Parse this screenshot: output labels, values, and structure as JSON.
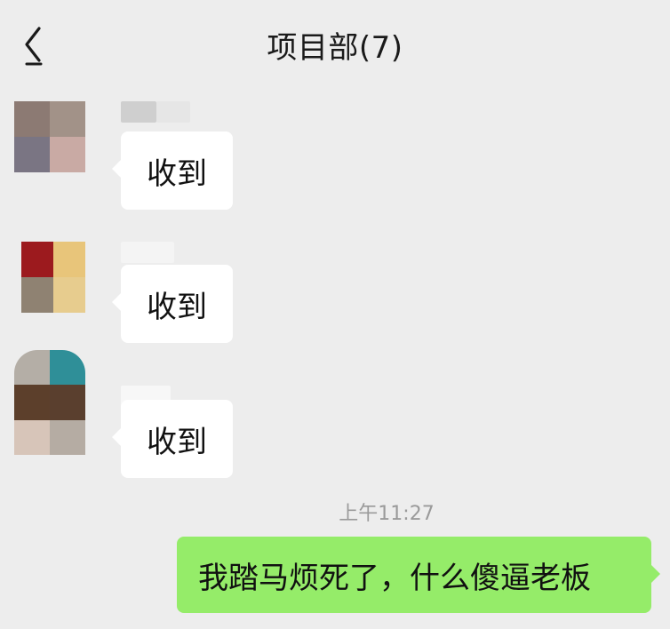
{
  "header": {
    "title": "项目部(7)",
    "back_icon": "chevron-left-icon"
  },
  "messages": [
    {
      "sender": "other",
      "text": "收到",
      "avatar_colors": [
        "#8c7a73",
        "#a29288",
        "#7a7583",
        "#c9aaa4"
      ],
      "name_colors": [
        "#cfcfcf",
        "#e6e6e6"
      ]
    },
    {
      "sender": "other",
      "text": "收到",
      "avatar_colors": [
        "#9c1a1e",
        "#e8c57a",
        "#8f8272",
        "#e7cc8e"
      ],
      "name_colors": [
        "#f4f4f4",
        "#f4f4f4"
      ]
    },
    {
      "sender": "other",
      "text": "收到",
      "avatar_colors": [
        "#b4aea6",
        "#2f8f98",
        "#5c3f2b",
        "#5a3f2e",
        "#d7c5b9",
        "#b5aca3"
      ],
      "name_colors": [
        "#f7f7f7",
        "#f7f7f7"
      ]
    }
  ],
  "timestamp": "上午11:27",
  "my_message": {
    "text": "我踏马烦死了，什么傻逼老板",
    "bubble_color": "#95ec69"
  }
}
